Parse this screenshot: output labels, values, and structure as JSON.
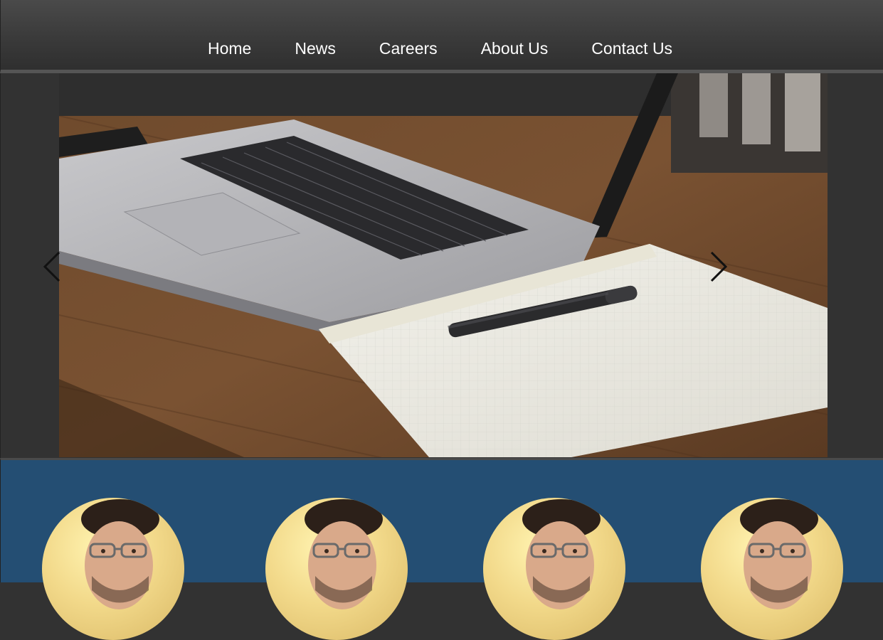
{
  "nav": {
    "items": [
      {
        "label": "Home"
      },
      {
        "label": "News"
      },
      {
        "label": "Careers"
      },
      {
        "label": "About Us"
      },
      {
        "label": "Contact Us"
      }
    ]
  },
  "carousel": {
    "slide_image": "laptop-notebook-pen-on-desk-photo",
    "prev_icon": "chevron-left-icon",
    "next_icon": "chevron-right-icon"
  },
  "team": {
    "members": [
      {
        "avatar": "person-portrait-photo"
      },
      {
        "avatar": "person-portrait-photo"
      },
      {
        "avatar": "person-portrait-photo"
      },
      {
        "avatar": "person-portrait-photo"
      }
    ],
    "background_color": "#244e73"
  },
  "colors": {
    "nav_bg": "#3a3a3a",
    "nav_text": "#ffffff",
    "page_bg": "#323232"
  }
}
